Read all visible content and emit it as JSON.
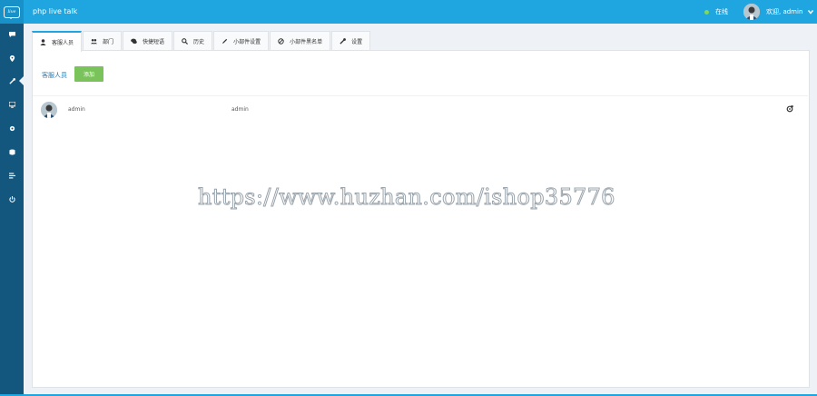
{
  "app": {
    "logo_text": "live",
    "title": "php live talk"
  },
  "header": {
    "status_text": "在线",
    "user_greeting": "欢迎, admin"
  },
  "tabs": [
    {
      "label": "客服人员",
      "icon": "user-icon",
      "active": true
    },
    {
      "label": "部门",
      "icon": "users-group-icon"
    },
    {
      "label": "快捷短语",
      "icon": "comments-icon"
    },
    {
      "label": "历史",
      "icon": "search-icon"
    },
    {
      "label": "小部件设置",
      "icon": "pencil-icon"
    },
    {
      "label": "小部件黑名单",
      "icon": "ban-icon"
    },
    {
      "label": "设置",
      "icon": "wrench-icon"
    }
  ],
  "section": {
    "label": "客服人员",
    "add_label": "添加"
  },
  "rows": [
    {
      "name": "admin",
      "nickname": "admin"
    }
  ],
  "watermark": "https://www.huzhan.com/ishop35776",
  "colors": {
    "topbar": "#1fa6e0",
    "sidebar": "#13567e",
    "add_button": "#7ac35b",
    "online": "#7ed957"
  }
}
